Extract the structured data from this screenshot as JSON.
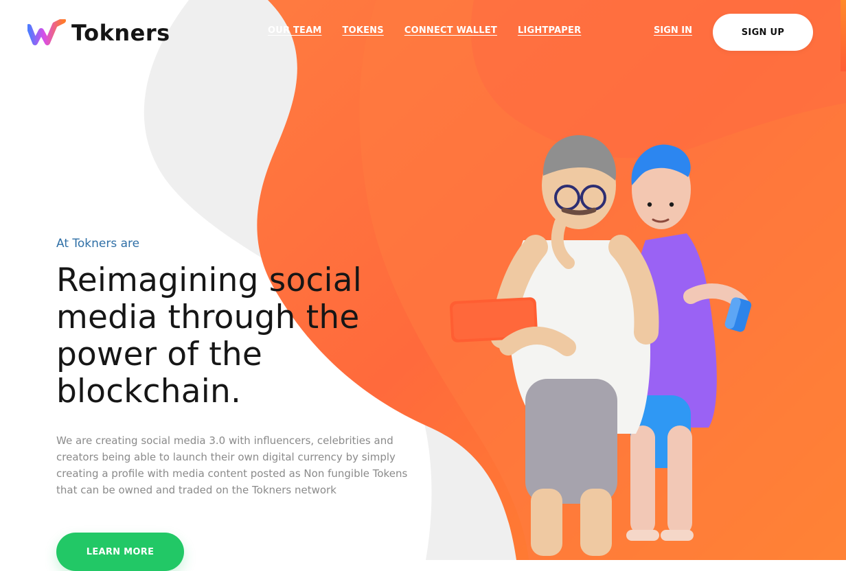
{
  "header": {
    "brand": "Tokners",
    "nav": [
      "OUR TEAM",
      "TOKENS",
      "CONNECT WALLET",
      "LIGHTPAPER"
    ],
    "sign_in": "SIGN IN",
    "sign_up": "SIGN UP"
  },
  "hero": {
    "eyebrow": "At Tokners are",
    "headline": "Reimagining social media through the power of the blockchain.",
    "body": "We are creating social media 3.0 with influencers, celebrities and creators being able to launch their own digital currency by simply creating a profile with media content posted as Non fungible Tokens that can be owned and traded on the Tokners network",
    "cta": "LEARN MORE"
  },
  "icons": {
    "brand": "brand-logo-icon"
  },
  "colors": {
    "accent_orange": "#ff6a3c",
    "accent_green": "#22c866",
    "link_blue": "#2f6fa6"
  }
}
